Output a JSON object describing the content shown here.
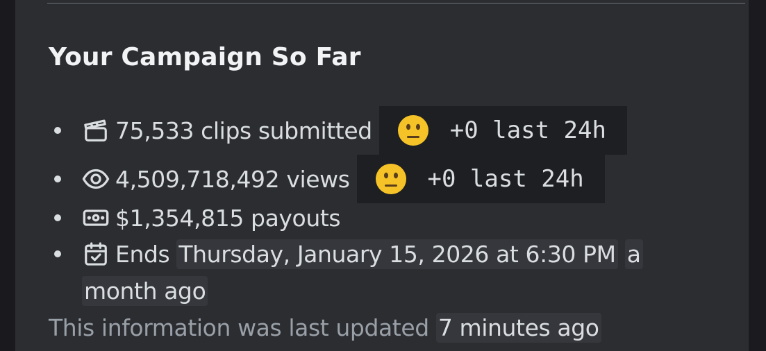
{
  "embed": {
    "title": "Your Campaign So Far",
    "stats": [
      {
        "icon": "clapperboard-icon",
        "text": "75,533 clips submitted",
        "change_emoji": "neutral-face-emoji",
        "change_text": "+0 last 24h"
      },
      {
        "icon": "eye-icon",
        "text": "4,509,718,492 views",
        "change_emoji": "neutral-face-emoji",
        "change_text": "+0 last 24h"
      },
      {
        "icon": "money-icon",
        "text": "$1,354,815 payouts"
      },
      {
        "icon": "calendar-check-icon",
        "prefix": "Ends",
        "date": "Thursday, January 15, 2026 at 6:30 PM",
        "relative_part1": "a",
        "relative_part2": "month ago"
      }
    ],
    "footer": {
      "text": "This information was last updated",
      "relative": "7 minutes ago"
    }
  },
  "colors": {
    "background": "#2b2d31",
    "code_background": "#1e1f22",
    "timestamp_background": "#35373c",
    "text": "#dbdee1",
    "muted_text": "#9aa0a8",
    "title": "#f2f3f5"
  }
}
